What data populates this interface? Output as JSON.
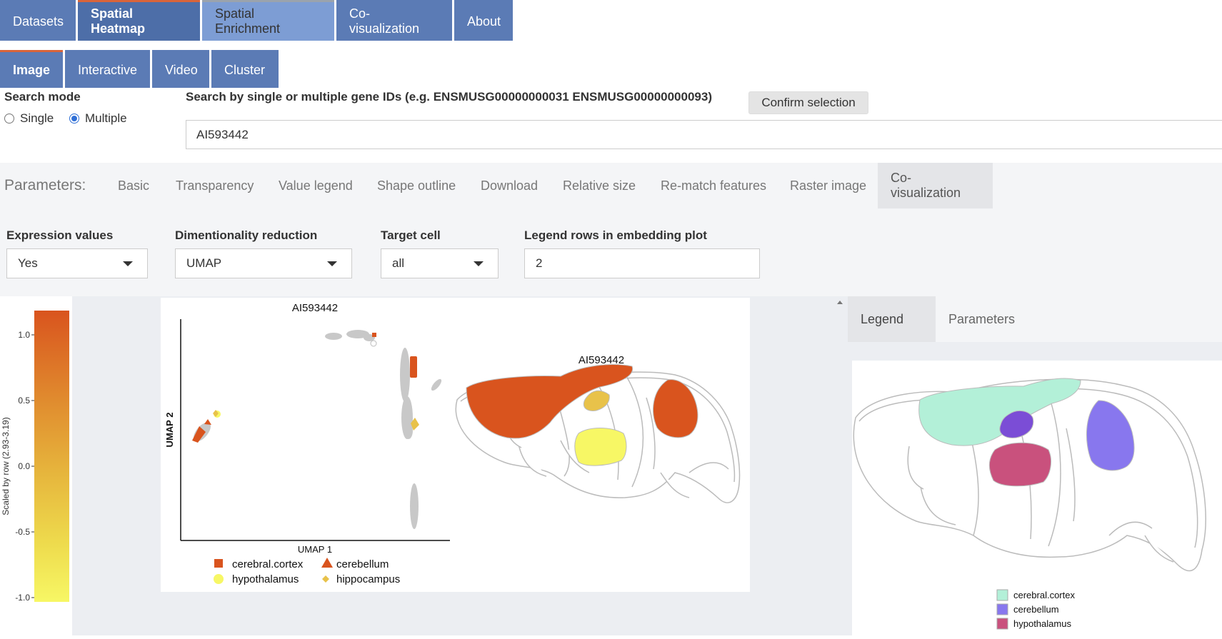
{
  "nav": {
    "tabs": [
      "Datasets",
      "Spatial Heatmap",
      "Spatial Enrichment",
      "Co-visualization",
      "About"
    ]
  },
  "subnav": {
    "tabs": [
      "Image",
      "Interactive",
      "Video",
      "Cluster"
    ]
  },
  "search": {
    "mode_label": "Search mode",
    "single_label": "Single",
    "multiple_label": "Multiple",
    "selected_mode": "Multiple",
    "gene_label": "Search by single or multiple gene IDs (e.g. ENSMUSG00000000031 ENSMUSG00000000093)",
    "confirm_label": "Confirm selection",
    "value": "AI593442"
  },
  "parameters": {
    "label": "Parameters:",
    "tabs": [
      "Basic",
      "Transparency",
      "Value legend",
      "Shape outline",
      "Download",
      "Relative size",
      "Re-match features",
      "Raster image",
      "Co-visualization"
    ],
    "active": "Co-visualization"
  },
  "controls": {
    "expr_label": "Expression values",
    "expr_value": "Yes",
    "dim_label": "Dimentionality reduction",
    "dim_value": "UMAP",
    "target_label": "Target cell",
    "target_value": "all",
    "rows_label": "Legend rows in embedding plot",
    "rows_value": "2"
  },
  "colorbar": {
    "axis_label": "Scaled by row (2.93-3.19)",
    "ticks": [
      "1.0",
      "0.5",
      "0.0",
      "-0.5",
      "-1.0"
    ],
    "colors": [
      "#d9541e",
      "#e08a2e",
      "#e6b43c",
      "#eedb4d",
      "#f7f765"
    ]
  },
  "embedding": {
    "title": "AI593442",
    "xlabel": "UMAP 1",
    "ylabel": "UMAP 2",
    "legend": [
      {
        "label": "cerebral.cortex",
        "shape": "square",
        "color": "#d9541e"
      },
      {
        "label": "cerebellum",
        "shape": "triangle",
        "color": "#d9541e"
      },
      {
        "label": "hypothalamus",
        "shape": "circle",
        "color": "#f7f765"
      },
      {
        "label": "hippocampus",
        "shape": "diamond",
        "color": "#e8c24a"
      }
    ]
  },
  "spatial": {
    "title": "AI593442"
  },
  "right_panel": {
    "tabs": [
      "Legend",
      "Parameters"
    ],
    "active": "Legend",
    "legend": [
      {
        "label": "cerebral.cortex",
        "color": "#b3f0d8"
      },
      {
        "label": "cerebellum",
        "color": "#8877ee"
      },
      {
        "label": "hypothalamus",
        "color": "#c9517d"
      }
    ]
  },
  "colors": {
    "nav": "#5b7bb5",
    "accent": "#d9643a",
    "high": "#d9541e",
    "low": "#f7f765"
  }
}
